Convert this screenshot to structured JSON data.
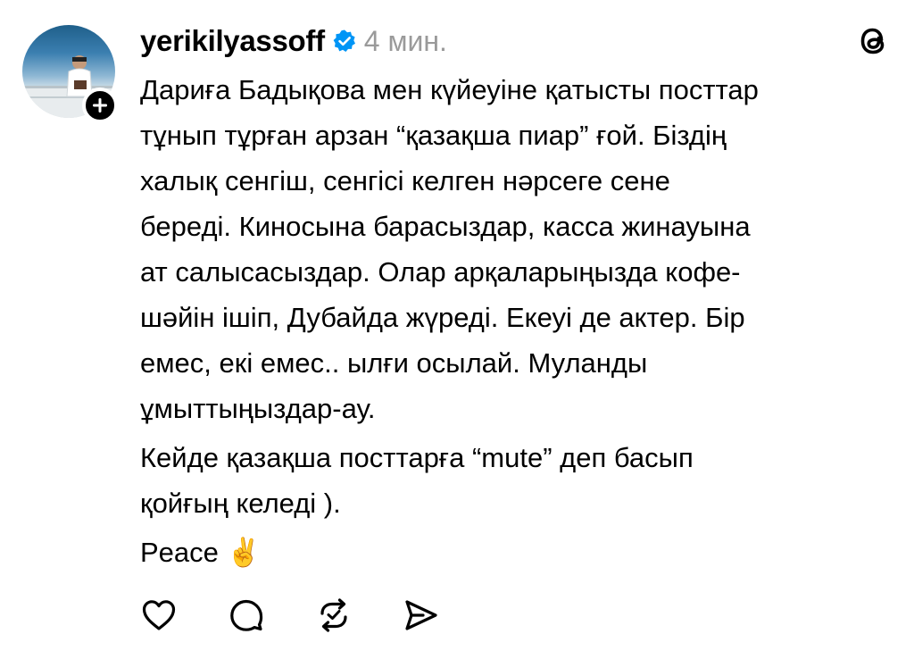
{
  "post": {
    "username": "yerikilyassoff",
    "time": "4 мин.",
    "paragraphs": [
      {
        "lines": [
          "Дариға Бадықова мен күйеуіне қатысты посттар",
          "тұнып тұрған арзан “қазақша пиар” ғой. Біздің",
          "халық сенгіш, сенгісі келген нәрсеге сене",
          "береді. Киносына барасыздар, касса жинауына",
          "ат салысасыздар. Олар арқаларыңызда кофе-",
          "шәйін ішіп, Дубайда жүреді. Екеуі де актер. Бір",
          "емес, екі емес.. ылғи осылай. Муланды",
          "ұмыттыңыздар-ау."
        ]
      },
      {
        "lines": [
          "Кейде қазақша посттарға “mute” деп басып",
          "қойғың келеді )."
        ]
      },
      {
        "lines": [
          "Peace ✌️"
        ]
      }
    ]
  },
  "icons": {
    "verified": "verified-badge-icon",
    "threads": "threads-logo-icon",
    "follow": "plus-icon",
    "actions": [
      "heart-icon",
      "comment-icon",
      "repost-icon",
      "share-icon"
    ]
  },
  "colors": {
    "verified_blue": "#0095f6",
    "time_gray": "#9a9a9a",
    "text": "#000000"
  }
}
